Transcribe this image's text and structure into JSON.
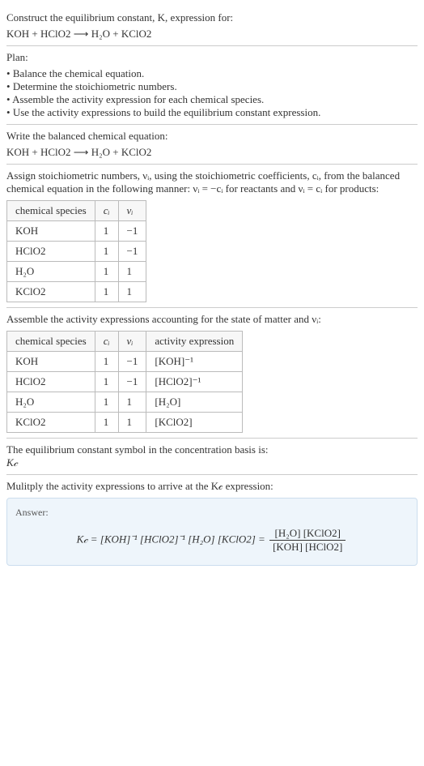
{
  "header": {
    "title": "Construct the equilibrium constant, K, expression for:",
    "equation": "KOH + HClO2  ⟶  H₂O + KClO2"
  },
  "plan": {
    "title": "Plan:",
    "items": [
      "Balance the chemical equation.",
      "Determine the stoichiometric numbers.",
      "Assemble the activity expression for each chemical species.",
      "Use the activity expressions to build the equilibrium constant expression."
    ]
  },
  "balanced": {
    "title": "Write the balanced chemical equation:",
    "equation": "KOH + HClO2  ⟶  H₂O + KClO2"
  },
  "stoich": {
    "intro": "Assign stoichiometric numbers, νᵢ, using the stoichiometric coefficients, cᵢ, from the balanced chemical equation in the following manner: νᵢ = −cᵢ for reactants and νᵢ = cᵢ for products:",
    "headers": [
      "chemical species",
      "cᵢ",
      "νᵢ"
    ],
    "rows": [
      {
        "species": "KOH",
        "c": "1",
        "v": "−1"
      },
      {
        "species": "HClO2",
        "c": "1",
        "v": "−1"
      },
      {
        "species": "H₂O",
        "c": "1",
        "v": "1"
      },
      {
        "species": "KClO2",
        "c": "1",
        "v": "1"
      }
    ]
  },
  "activity": {
    "intro": "Assemble the activity expressions accounting for the state of matter and νᵢ:",
    "headers": [
      "chemical species",
      "cᵢ",
      "νᵢ",
      "activity expression"
    ],
    "rows": [
      {
        "species": "KOH",
        "c": "1",
        "v": "−1",
        "expr": "[KOH]⁻¹"
      },
      {
        "species": "HClO2",
        "c": "1",
        "v": "−1",
        "expr": "[HClO2]⁻¹"
      },
      {
        "species": "H₂O",
        "c": "1",
        "v": "1",
        "expr": "[H₂O]"
      },
      {
        "species": "KClO2",
        "c": "1",
        "v": "1",
        "expr": "[KClO2]"
      }
    ]
  },
  "symbol": {
    "intro": "The equilibrium constant symbol in the concentration basis is:",
    "value": "K𝒸"
  },
  "multiply": {
    "intro": "Mulitply the activity expressions to arrive at the K𝒸 expression:"
  },
  "answer": {
    "label": "Answer:",
    "left": "K𝒸 = [KOH]⁻¹ [HClO2]⁻¹ [H₂O] [KClO2] =",
    "num": "[H₂O] [KClO2]",
    "den": "[KOH] [HClO2]"
  }
}
